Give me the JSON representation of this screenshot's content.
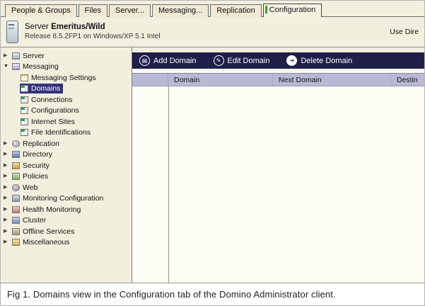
{
  "tabs": [
    {
      "label": "People & Groups",
      "active": false
    },
    {
      "label": "Files",
      "active": false
    },
    {
      "label": "Server...",
      "active": false
    },
    {
      "label": "Messaging...",
      "active": false
    },
    {
      "label": "Replication",
      "active": false
    },
    {
      "label": "Configuration",
      "active": true
    }
  ],
  "server_header": {
    "label": "Server",
    "name": "Emeritus/Wild",
    "release": "Release 8.5.2FP1 on Windows/XP 5.1 Intel",
    "right_text": "Use Dire"
  },
  "sidebar": {
    "items": [
      {
        "label": "Server",
        "level": 0,
        "state": "collapsed",
        "icon": "server-icon"
      },
      {
        "label": "Messaging",
        "level": 0,
        "state": "expanded",
        "icon": "messaging-icon"
      },
      {
        "label": "Messaging Settings",
        "level": 1,
        "icon": "document-icon"
      },
      {
        "label": "Domains",
        "level": 1,
        "icon": "table-view-icon",
        "selected": true
      },
      {
        "label": "Connections",
        "level": 1,
        "icon": "table-view-icon"
      },
      {
        "label": "Configurations",
        "level": 1,
        "icon": "table-view-icon"
      },
      {
        "label": "Internet Sites",
        "level": 1,
        "icon": "table-view-icon"
      },
      {
        "label": "File Identifications",
        "level": 1,
        "icon": "table-view-icon"
      },
      {
        "label": "Replication",
        "level": 0,
        "state": "collapsed",
        "icon": "replication-icon"
      },
      {
        "label": "Directory",
        "level": 0,
        "state": "collapsed",
        "icon": "directory-icon"
      },
      {
        "label": "Security",
        "level": 0,
        "state": "collapsed",
        "icon": "security-icon"
      },
      {
        "label": "Policies",
        "level": 0,
        "state": "collapsed",
        "icon": "policies-icon"
      },
      {
        "label": "Web",
        "level": 0,
        "state": "collapsed",
        "icon": "web-icon"
      },
      {
        "label": "Monitoring Configuration",
        "level": 0,
        "state": "collapsed",
        "icon": "monitoring-icon"
      },
      {
        "label": "Health Monitoring",
        "level": 0,
        "state": "collapsed",
        "icon": "health-icon"
      },
      {
        "label": "Cluster",
        "level": 0,
        "state": "collapsed",
        "icon": "cluster-icon"
      },
      {
        "label": "Offline Services",
        "level": 0,
        "state": "collapsed",
        "icon": "offline-icon"
      },
      {
        "label": "Miscellaneous",
        "level": 0,
        "state": "collapsed",
        "icon": "misc-icon"
      }
    ]
  },
  "action_bar": {
    "buttons": [
      {
        "label": "Add Domain",
        "icon": "add-domain-icon",
        "glyph": "▤"
      },
      {
        "label": "Edit Domain",
        "icon": "edit-domain-icon",
        "glyph": "✎"
      },
      {
        "label": "Delete Domain",
        "icon": "delete-domain-icon",
        "glyph": "➔"
      }
    ]
  },
  "table": {
    "columns": [
      "Domain",
      "Next Domain",
      "Destin"
    ]
  },
  "caption": {
    "text": "Fig 1. Domains view in the Configuration tab of the Domino Administrator client."
  }
}
